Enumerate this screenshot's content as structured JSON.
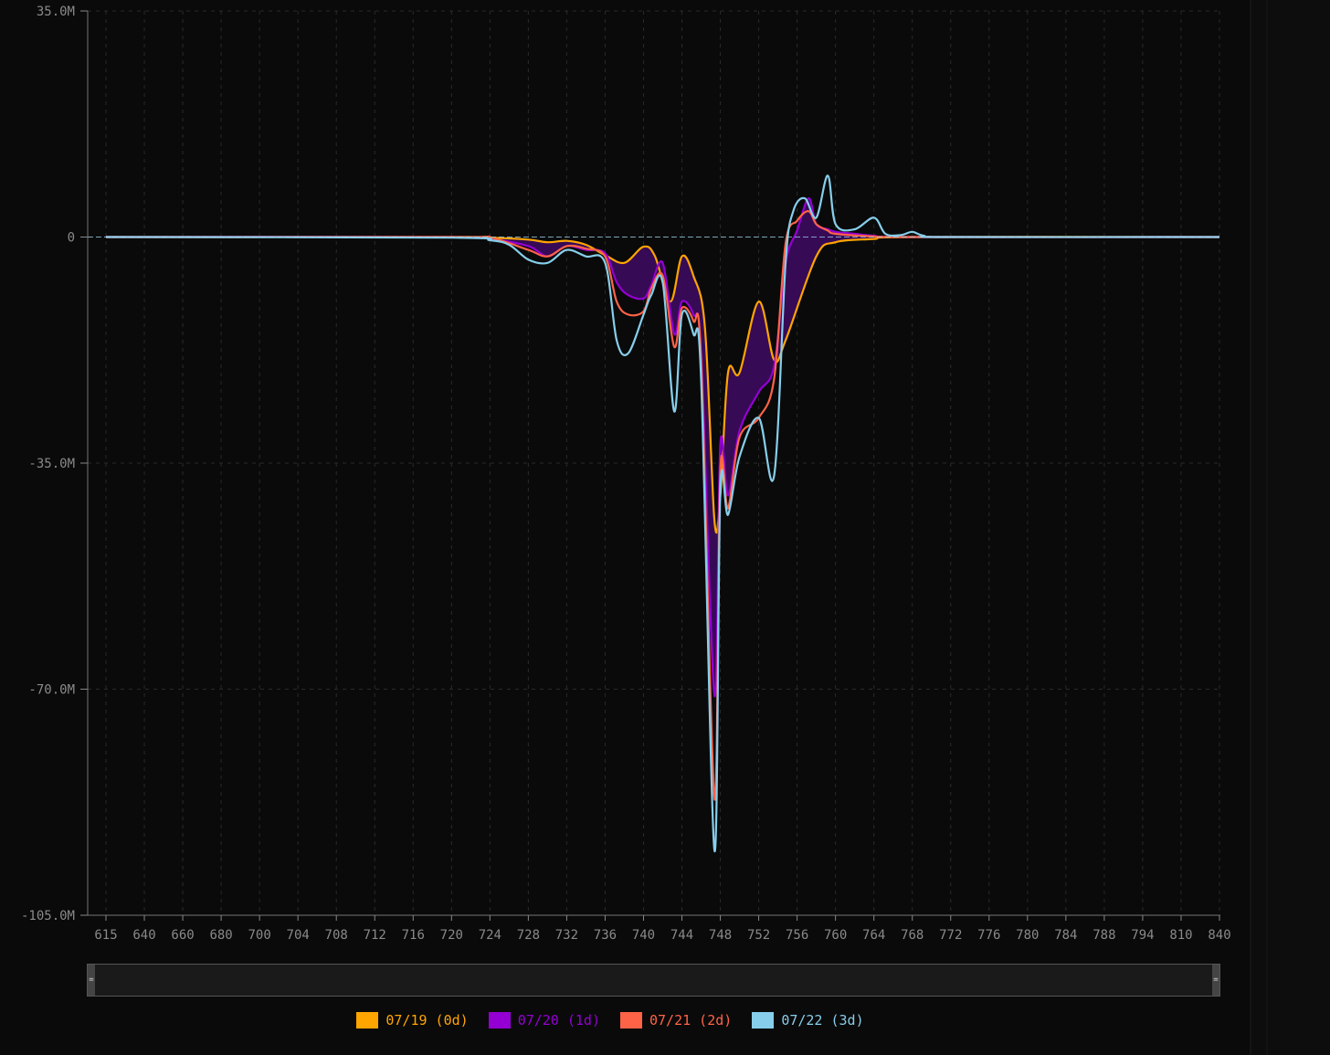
{
  "chart_data": {
    "type": "area",
    "x_categories": [
      "615",
      "640",
      "660",
      "680",
      "700",
      "704",
      "708",
      "712",
      "716",
      "720",
      "724",
      "728",
      "732",
      "736",
      "740",
      "744",
      "748",
      "752",
      "756",
      "760",
      "764",
      "768",
      "772",
      "776",
      "780",
      "784",
      "788",
      "794",
      "810",
      "840"
    ],
    "y_ticks": [
      35000000,
      0,
      -35000000,
      -70000000,
      -105000000
    ],
    "y_tick_labels": [
      "35.0M",
      "0",
      "-35.0M",
      "-70.0M",
      "-105.0M"
    ],
    "ylim": [
      -105000000,
      35000000
    ],
    "grid": true,
    "legend_position": "bottom-center",
    "series": [
      {
        "name": "07/19 (0d)",
        "color": "#ffa500",
        "points": [
          [
            0,
            0
          ],
          [
            9,
            0
          ],
          [
            10,
            -0.1
          ],
          [
            11,
            -0.4
          ],
          [
            11.5,
            -0.8
          ],
          [
            12,
            -0.6
          ],
          [
            12.5,
            -1.2
          ],
          [
            13,
            -2.8
          ],
          [
            13.5,
            -4
          ],
          [
            14,
            -1.5
          ],
          [
            14.3,
            -3
          ],
          [
            14.7,
            -10
          ],
          [
            15,
            -3
          ],
          [
            15.3,
            -6
          ],
          [
            15.6,
            -14
          ],
          [
            15.85,
            -44
          ],
          [
            16,
            -40
          ],
          [
            16.2,
            -21
          ],
          [
            16.5,
            -21
          ],
          [
            17,
            -10
          ],
          [
            17.4,
            -19
          ],
          [
            17.7,
            -16
          ],
          [
            18.5,
            -3
          ],
          [
            19,
            -0.8
          ],
          [
            20,
            -0.3
          ],
          [
            21,
            0
          ],
          [
            29,
            0
          ]
        ]
      },
      {
        "name": "07/20 (1d)",
        "color": "#9400d3",
        "points": [
          [
            0,
            0
          ],
          [
            9,
            0
          ],
          [
            10,
            -0.3
          ],
          [
            11,
            -1.4
          ],
          [
            11.5,
            -3
          ],
          [
            12,
            -1.4
          ],
          [
            12.5,
            -2
          ],
          [
            13,
            -2.5
          ],
          [
            13.3,
            -7
          ],
          [
            13.6,
            -9
          ],
          [
            14,
            -9.5
          ],
          [
            14.2,
            -7.5
          ],
          [
            14.5,
            -4
          ],
          [
            14.8,
            -15
          ],
          [
            15,
            -10
          ],
          [
            15.3,
            -12
          ],
          [
            15.5,
            -18
          ],
          [
            15.85,
            -71
          ],
          [
            16,
            -32
          ],
          [
            16.2,
            -40
          ],
          [
            16.5,
            -30
          ],
          [
            17,
            -24
          ],
          [
            17.4,
            -20
          ],
          [
            17.7,
            -4
          ],
          [
            18,
            1
          ],
          [
            18.3,
            6
          ],
          [
            18.5,
            2
          ],
          [
            18.8,
            1.2
          ],
          [
            19,
            0.8
          ],
          [
            19.5,
            0.5
          ],
          [
            20,
            0.2
          ],
          [
            21,
            0
          ],
          [
            29,
            0
          ]
        ]
      },
      {
        "name": "07/21 (2d)",
        "color": "#ff6347",
        "points": [
          [
            0,
            0
          ],
          [
            9,
            0
          ],
          [
            10,
            -0.1
          ],
          [
            11,
            -2
          ],
          [
            11.5,
            -3
          ],
          [
            12,
            -1.4
          ],
          [
            12.5,
            -1.8
          ],
          [
            13,
            -3
          ],
          [
            13.3,
            -10
          ],
          [
            13.6,
            -12
          ],
          [
            14,
            -11.5
          ],
          [
            14.2,
            -8
          ],
          [
            14.5,
            -6
          ],
          [
            14.8,
            -17
          ],
          [
            15,
            -11
          ],
          [
            15.3,
            -13
          ],
          [
            15.5,
            -19
          ],
          [
            15.85,
            -87
          ],
          [
            16,
            -36
          ],
          [
            16.2,
            -42
          ],
          [
            16.5,
            -31
          ],
          [
            17,
            -28
          ],
          [
            17.4,
            -22
          ],
          [
            17.7,
            -1
          ],
          [
            18,
            2.5
          ],
          [
            18.3,
            4
          ],
          [
            18.5,
            2
          ],
          [
            18.8,
            1
          ],
          [
            19,
            0.5
          ],
          [
            20,
            0.1
          ],
          [
            21,
            0
          ],
          [
            29,
            0
          ]
        ]
      },
      {
        "name": "07/22 (3d)",
        "color": "#87ceeb",
        "points": [
          [
            0,
            0
          ],
          [
            9,
            -0.1
          ],
          [
            10,
            -0.5
          ],
          [
            10.5,
            -1.2
          ],
          [
            11,
            -3.5
          ],
          [
            11.5,
            -4
          ],
          [
            12,
            -2
          ],
          [
            12.5,
            -3
          ],
          [
            13,
            -4
          ],
          [
            13.3,
            -16
          ],
          [
            13.6,
            -18
          ],
          [
            14,
            -12
          ],
          [
            14.2,
            -9
          ],
          [
            14.5,
            -7
          ],
          [
            14.8,
            -27
          ],
          [
            15,
            -12
          ],
          [
            15.3,
            -15
          ],
          [
            15.5,
            -22
          ],
          [
            15.85,
            -95
          ],
          [
            16,
            -39
          ],
          [
            16.2,
            -43
          ],
          [
            16.5,
            -34
          ],
          [
            17,
            -28
          ],
          [
            17.4,
            -37
          ],
          [
            17.7,
            -4
          ],
          [
            17.9,
            4
          ],
          [
            18.2,
            6
          ],
          [
            18.5,
            3
          ],
          [
            18.8,
            9.5
          ],
          [
            19,
            2
          ],
          [
            19.5,
            1.2
          ],
          [
            20,
            3
          ],
          [
            20.3,
            0.5
          ],
          [
            20.7,
            0.3
          ],
          [
            21,
            0.8
          ],
          [
            21.3,
            0.2
          ],
          [
            22,
            0
          ],
          [
            29,
            0
          ]
        ]
      }
    ]
  }
}
